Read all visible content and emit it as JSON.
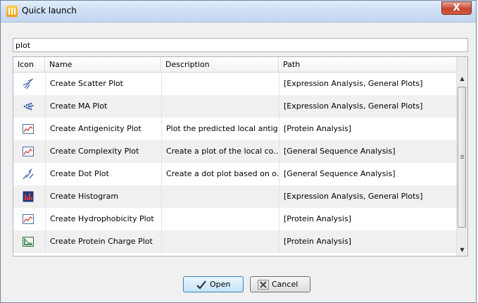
{
  "window": {
    "title": "Quick launch",
    "close_label": "X"
  },
  "search": {
    "value": "plot"
  },
  "table": {
    "columns": [
      "Icon",
      "Name",
      "Description",
      "Path"
    ],
    "rows": [
      {
        "icon": "scatter-plot-icon",
        "name": "Create Scatter Plot",
        "description": "",
        "path": "[Expression Analysis, General Plots]"
      },
      {
        "icon": "ma-plot-icon",
        "name": "Create MA Plot",
        "description": "",
        "path": "[Expression Analysis, General Plots]"
      },
      {
        "icon": "line-chart-icon",
        "name": "Create Antigenicity Plot",
        "description": "Plot the predicted local antig...",
        "path": "[Protein Analysis]"
      },
      {
        "icon": "line-chart-icon",
        "name": "Create Complexity Plot",
        "description": "Create a plot of the local co...",
        "path": "[General Sequence Analysis]"
      },
      {
        "icon": "dot-plot-icon",
        "name": "Create Dot Plot",
        "description": "Create a dot plot based on o...",
        "path": "[General Sequence Analysis]"
      },
      {
        "icon": "histogram-icon",
        "name": "Create Histogram",
        "description": "",
        "path": "[Expression Analysis, General Plots]"
      },
      {
        "icon": "line-chart-icon",
        "name": "Create Hydrophobicity Plot",
        "description": "",
        "path": "[Protein Analysis]"
      },
      {
        "icon": "charge-plot-icon",
        "name": "Create Protein Charge Plot",
        "description": "",
        "path": "[Protein Analysis]"
      }
    ]
  },
  "buttons": {
    "open": "Open",
    "cancel": "Cancel"
  }
}
